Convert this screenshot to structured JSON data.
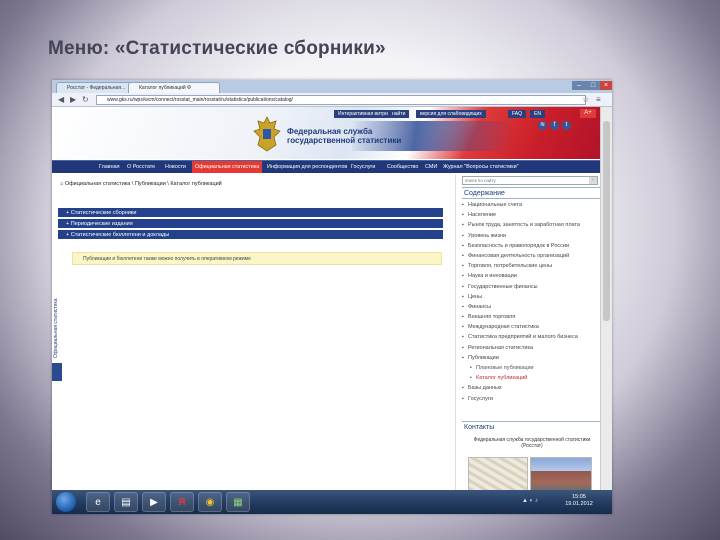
{
  "slide": {
    "title": "Меню: «Статистические сборники»"
  },
  "browser": {
    "tabs": [
      "Росстат - Федеральная...",
      "Каталог публикаций Ф"
    ],
    "url": "www.gks.ru/wps/wcm/connect/rosstat_main/rosstat/ru/statistics/publications/catalog/"
  },
  "site": {
    "agency_line1": "Федеральная служба",
    "agency_line2": "государственной статистики",
    "top_links": [
      "Интерактивная витрина",
      "найти",
      "версия для слабовидящих",
      "FAQ",
      "EN"
    ],
    "font_size_btn": "А+",
    "menu": [
      "Главная",
      "О Росстате",
      "Новости",
      "Официальная статистика",
      "Информация для респондентов",
      "Госуслуги",
      "Сообщество",
      "СМИ",
      "Журнал \"Вопросы статистики\""
    ],
    "breadcrumb": "Официальная статистика \\ Публикации \\ Каталог публикаций",
    "accordion": [
      "Статистические сборники",
      "Периодические издания",
      "Статистические бюллетени и доклады"
    ],
    "notice": "Публикации и бюллетени также можно получить в оперативном режиме",
    "vertical_label": "Официальная статистика",
    "search_placeholder": "поиск по сайту",
    "sidebar_heading": "Содержание",
    "sidebar_items": [
      {
        "label": "Национальные счета",
        "sub": false,
        "red": false
      },
      {
        "label": "Население",
        "sub": false,
        "red": false
      },
      {
        "label": "Рынок труда, занятость и заработная плата",
        "sub": false,
        "red": false
      },
      {
        "label": "Уровень жизни",
        "sub": false,
        "red": false
      },
      {
        "label": "Безопасность и правопорядок в России",
        "sub": false,
        "red": false
      },
      {
        "label": "Финансовая деятельность организаций",
        "sub": false,
        "red": false
      },
      {
        "label": "Торговля, потребительские цены",
        "sub": false,
        "red": false
      },
      {
        "label": "Наука и инновации",
        "sub": false,
        "red": false
      },
      {
        "label": "Государственные финансы",
        "sub": false,
        "red": false
      },
      {
        "label": "Цены",
        "sub": false,
        "red": false
      },
      {
        "label": "Финансы",
        "sub": false,
        "red": false
      },
      {
        "label": "Внешняя торговля",
        "sub": false,
        "red": false
      },
      {
        "label": "Международная статистика",
        "sub": false,
        "red": false
      },
      {
        "label": "Статистика предприятий и малого бизнеса",
        "sub": false,
        "red": false
      },
      {
        "label": "Региональная статистика",
        "sub": false,
        "red": false
      },
      {
        "label": "Публикации",
        "sub": false,
        "red": false
      },
      {
        "label": "Плановые публикации",
        "sub": true,
        "red": false
      },
      {
        "label": "Каталог публикаций",
        "sub": true,
        "red": true
      },
      {
        "label": "Базы данных",
        "sub": false,
        "red": false
      },
      {
        "label": "Госуслуги",
        "sub": false,
        "red": false
      }
    ],
    "contacts_heading": "Контакты",
    "contacts_text": "Федеральная служба государственной статистики (Росстат)"
  },
  "taskbar": {
    "time": "15:05",
    "date": "19.01.2012"
  }
}
